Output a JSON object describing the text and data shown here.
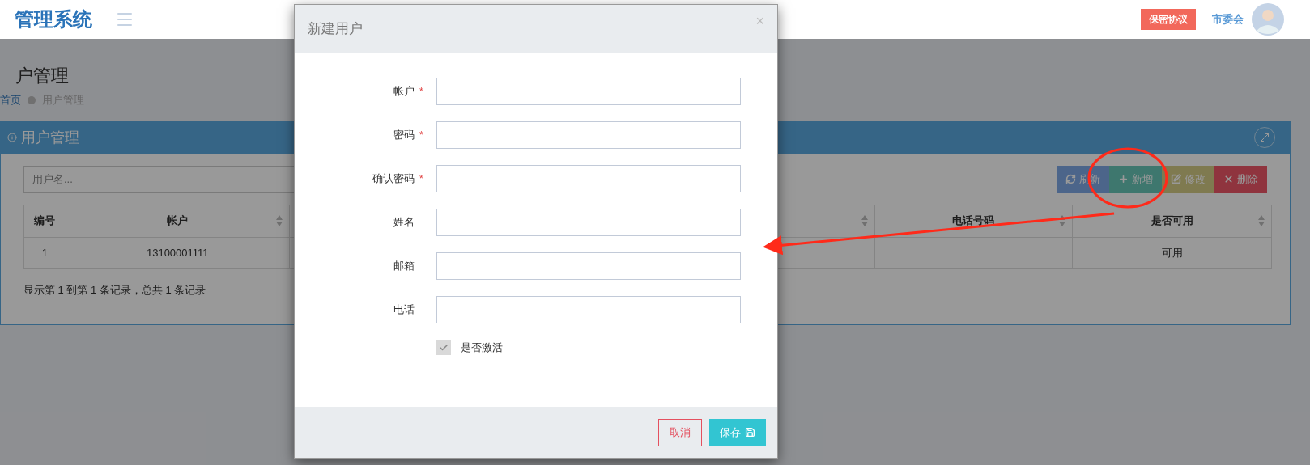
{
  "header": {
    "title": "管理系统",
    "notice_button": "保密协议",
    "user_name": "市委会"
  },
  "page": {
    "title": "户管理",
    "breadcrumb": [
      {
        "label": "首页",
        "selected": false
      },
      {
        "label": "用户管理",
        "selected": true
      }
    ]
  },
  "panel": {
    "title": "用户管理",
    "search": {
      "placeholder": "用户名..."
    },
    "toolbar": [
      {
        "kind": "refresh",
        "label": "刷新"
      },
      {
        "kind": "add",
        "label": "新增"
      },
      {
        "kind": "edit",
        "label": "修改"
      },
      {
        "kind": "delete",
        "label": "删除"
      }
    ],
    "table": {
      "columns": [
        {
          "label": "编号",
          "sortable": false
        },
        {
          "label": "帐户",
          "sortable": true
        },
        {
          "sortable": true
        },
        {
          "label": "电话号码",
          "sortable": true
        },
        {
          "label": "是否可用",
          "sortable": true
        }
      ],
      "rows": [
        {
          "cells": [
            {
              "text": "1"
            },
            {
              "text": "13100001111"
            },
            {},
            {},
            {
              "text": "可用"
            }
          ]
        }
      ]
    },
    "pagination_info": "显示第 1 到第 1 条记录，总共 1 条记录"
  },
  "dialog": {
    "title": "新建用户",
    "close": "×",
    "fields": [
      {
        "label": "帐户",
        "marker": "*"
      },
      {
        "label": "密码",
        "marker": "*"
      },
      {
        "label": "确认密码",
        "marker": "*"
      },
      {
        "label": "姓名"
      },
      {
        "label": "邮箱"
      },
      {
        "label": "电话"
      }
    ],
    "active": {
      "label": "是否激活",
      "checked": true
    },
    "buttons": [
      {
        "kind": "cancel",
        "label": "取消"
      },
      {
        "kind": "save",
        "label": "保存"
      }
    ]
  }
}
